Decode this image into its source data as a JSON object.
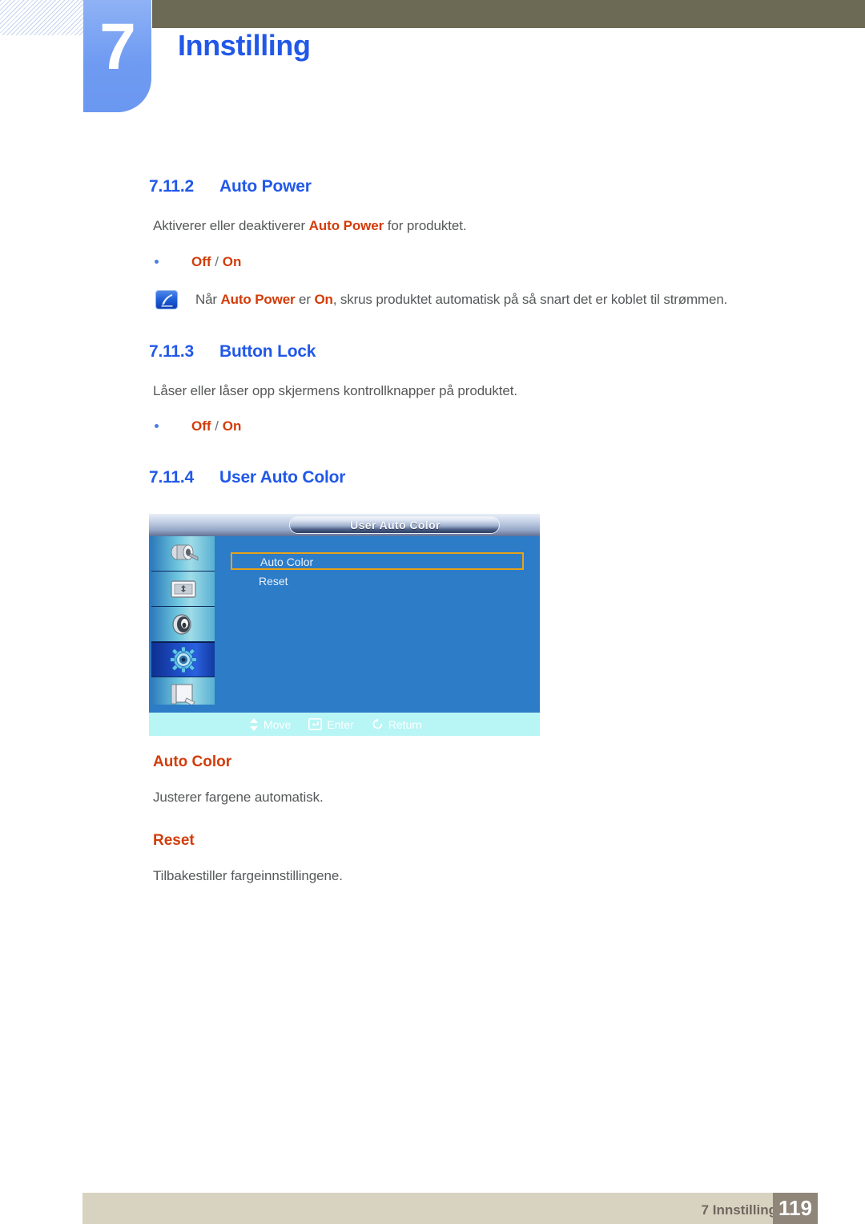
{
  "header": {
    "chapter_number": "7",
    "chapter_title": "Innstilling"
  },
  "sections": [
    {
      "number": "7.11.2",
      "title": "Auto Power",
      "paragraph_pre": "Aktiverer eller deaktiverer ",
      "paragraph_hl": "Auto Power",
      "paragraph_post": " for produktet.",
      "bullet_a": "Off",
      "bullet_sep": " / ",
      "bullet_b": "On"
    },
    {
      "number": "7.11.3",
      "title": "Button Lock",
      "paragraph": "Låser eller låser opp skjermens kontrollknapper på produktet.",
      "bullet_a": "Off",
      "bullet_sep": " / ",
      "bullet_b": "On"
    },
    {
      "number": "7.11.4",
      "title": "User Auto Color"
    }
  ],
  "note": {
    "icon": "note-quill-icon",
    "t1": "Når ",
    "h1": "Auto Power",
    "t2": " er ",
    "h2": "On",
    "t3": ", skrus produktet automatisk på så snart det er koblet til strømmen."
  },
  "osd": {
    "title": "User Auto Color",
    "sidebar_icons": [
      "picture-roller-icon",
      "screen-adjust-icon",
      "sound-speaker-icon",
      "setup-gear-icon",
      "information-icon"
    ],
    "menu_items": [
      {
        "label": "Auto Color",
        "selected": true
      },
      {
        "label": "Reset",
        "selected": false
      }
    ],
    "hints": [
      {
        "icon": "updown-arrow-icon",
        "label": "Move"
      },
      {
        "icon": "enter-key-icon",
        "label": "Enter"
      },
      {
        "icon": "return-arrow-icon",
        "label": "Return"
      }
    ],
    "selection_color": "#e8a317",
    "panel_color": "#2d7cc8",
    "bottom_bar_color": "#b8f5f5"
  },
  "subsections": [
    {
      "title": "Auto Color",
      "body": "Justerer fargene automatisk."
    },
    {
      "title": "Reset",
      "body": "Tilbakestiller fargeinnstillingene."
    }
  ],
  "footer": {
    "label": "7 Innstilling",
    "page": "119"
  },
  "colors": {
    "heading_blue": "#2158e8",
    "accent_orange": "#d23c0a",
    "olive": "#6c6a55",
    "footer_beige": "#d8d3c0",
    "footer_page_bg": "#8f8579"
  }
}
